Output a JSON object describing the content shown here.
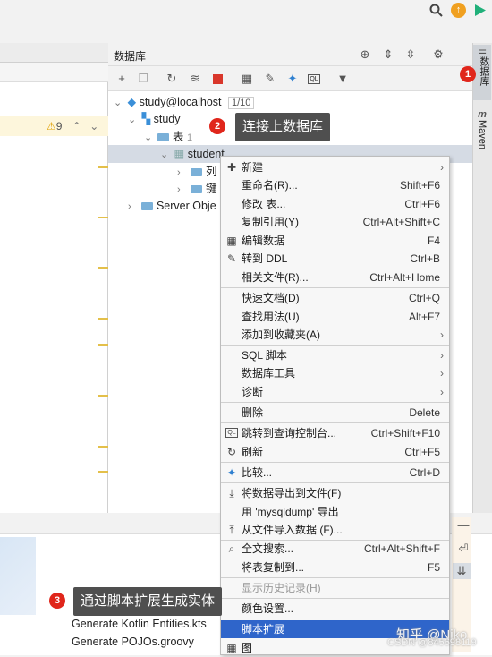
{
  "colors": {
    "accent": "#2f65ca",
    "badge": "#e0261b",
    "callout": "#4f4f4f"
  },
  "db_panel": {
    "title": "数据库",
    "connection": "study@localhost",
    "connection_count": "1/10",
    "schema": "study",
    "tables_folder": "表",
    "tables_count": "1",
    "table": "student",
    "columns_folder": "列",
    "keys_folder": "键",
    "server_objects": "Server Obje"
  },
  "editor": {
    "warning_count": "9"
  },
  "right_sidebar": {
    "database_tab": "数据库",
    "maven_tab": "Maven"
  },
  "annotations": [
    {
      "num": "1"
    },
    {
      "num": "2",
      "text": "连接上数据库"
    },
    {
      "num": "3",
      "text": "通过脚本扩展生成实体"
    }
  ],
  "menu": {
    "items": [
      {
        "label": "新建",
        "shortcut": "",
        "submenu": true,
        "icon": "plus-icon"
      },
      {
        "label": "重命名(R)...",
        "shortcut": "Shift+F6"
      },
      {
        "label": "修改 表...",
        "shortcut": "Ctrl+F6"
      },
      {
        "label": "复制引用(Y)",
        "shortcut": "Ctrl+Alt+Shift+C"
      },
      {
        "label": "编辑数据",
        "shortcut": "F4",
        "icon": "table-icon"
      },
      {
        "label": "转到 DDL",
        "shortcut": "Ctrl+B",
        "icon": "pencil-icon"
      },
      {
        "label": "相关文件(R)...",
        "shortcut": "Ctrl+Alt+Home"
      },
      {
        "label": "快速文档(D)",
        "shortcut": "Ctrl+Q"
      },
      {
        "label": "查找用法(U)",
        "shortcut": "Alt+F7"
      },
      {
        "label": "添加到收藏夹(A)",
        "shortcut": "",
        "submenu": true
      },
      {
        "label": "SQL 脚本",
        "shortcut": "",
        "submenu": true
      },
      {
        "label": "数据库工具",
        "shortcut": "",
        "submenu": true
      },
      {
        "label": "诊断",
        "shortcut": "",
        "submenu": true
      },
      {
        "label": "删除",
        "shortcut": "Delete"
      },
      {
        "label": "跳转到查询控制台...",
        "shortcut": "Ctrl+Shift+F10",
        "icon": "console-icon"
      },
      {
        "label": "刷新",
        "shortcut": "Ctrl+F5",
        "icon": "refresh-icon"
      },
      {
        "label": "比较...",
        "shortcut": "Ctrl+D",
        "icon": "compare-icon"
      },
      {
        "label": "将数据导出到文件(F)",
        "shortcut": "",
        "icon": "export-icon"
      },
      {
        "label": "用 'mysqldump' 导出",
        "shortcut": ""
      },
      {
        "label": "从文件导入数据 (F)...",
        "shortcut": "",
        "icon": "import-icon"
      },
      {
        "label": "全文搜索...",
        "shortcut": "Ctrl+Alt+Shift+F",
        "icon": "search-icon"
      },
      {
        "label": "将表复制到...",
        "shortcut": "F5"
      },
      {
        "label": "显示历史记录(H)",
        "shortcut": "",
        "disabled": true
      },
      {
        "label": "颜色设置...",
        "shortcut": ""
      },
      {
        "label": "脚本扩展",
        "shortcut": "",
        "selected": true
      },
      {
        "label": "图",
        "shortcut": "",
        "icon": "diagram-icon"
      }
    ]
  },
  "script_submenu": {
    "items": [
      "Generate Kotlin Entities.kts",
      "Generate POJOs.groovy"
    ]
  },
  "watermark": {
    "zhihu": "知乎 @Niko",
    "csdn": "CSDN @845698119"
  }
}
